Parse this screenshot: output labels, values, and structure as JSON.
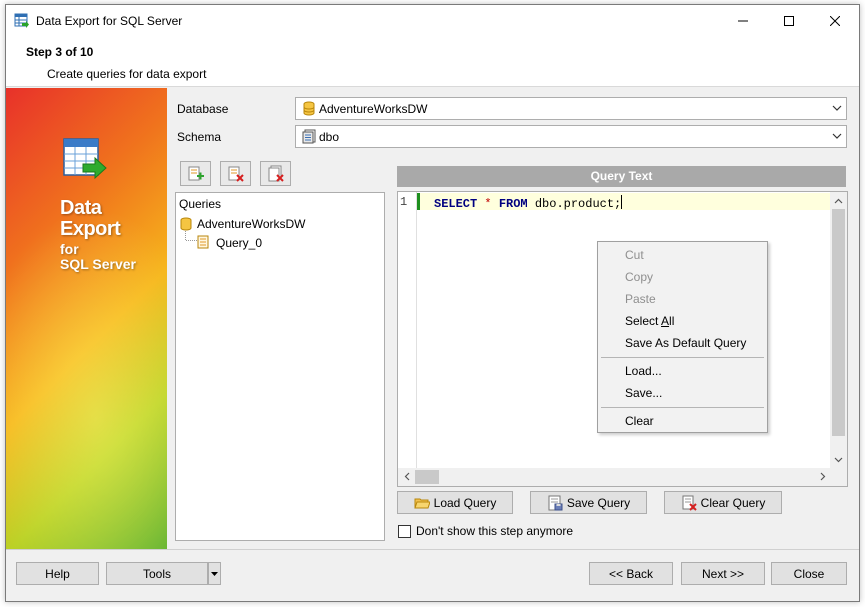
{
  "window": {
    "title": "Data Export for SQL Server"
  },
  "header": {
    "step": "Step 3 of 10",
    "subtitle": "Create queries for data export"
  },
  "banner": {
    "line1": "Data",
    "line2": "Export",
    "line3": "for",
    "line4": "SQL Server"
  },
  "form": {
    "database_label": "Database",
    "database_value": "AdventureWorksDW",
    "schema_label": "Schema",
    "schema_value": "dbo"
  },
  "tree": {
    "root": "Queries",
    "database": "AdventureWorksDW",
    "query": "Query_0"
  },
  "editor": {
    "header": "Query Text",
    "line_number": "1",
    "kw1": "SELECT",
    "star": "*",
    "kw2": "FROM",
    "rest": "dbo.product;"
  },
  "context_menu": {
    "cut": "Cut",
    "copy": "Copy",
    "paste": "Paste",
    "select_all_pre": "Select ",
    "select_all_u": "A",
    "select_all_post": "ll",
    "save_default": "Save As Default Query",
    "load": "Load...",
    "save": "Save...",
    "clear": "Clear"
  },
  "actions": {
    "load_query": "Load Query",
    "save_query": "Save Query",
    "clear_query": "Clear Query",
    "dont_show": "Don't show this step anymore"
  },
  "footer": {
    "help": "Help",
    "tools": "Tools",
    "back": "<< Back",
    "next": "Next >>",
    "close": "Close"
  },
  "colors": {
    "query_header_bg": "#a9a9a9",
    "current_line_bg": "#ffffdd",
    "keyword": "#000080",
    "operator": "#c00000"
  }
}
